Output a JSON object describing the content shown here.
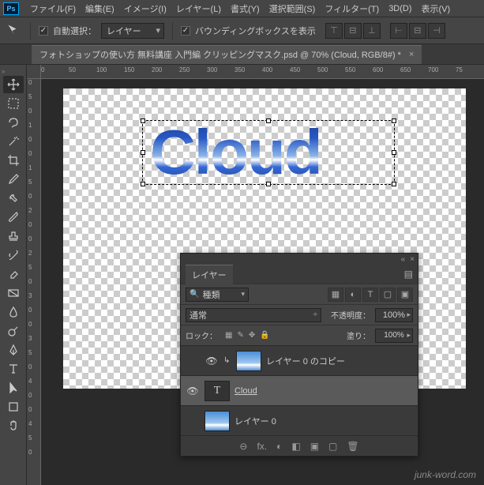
{
  "app": {
    "logo": "Ps"
  },
  "menu": [
    "ファイル(F)",
    "編集(E)",
    "イメージ(I)",
    "レイヤー(L)",
    "書式(Y)",
    "選択範囲(S)",
    "フィルター(T)",
    "3D(D)",
    "表示(V)"
  ],
  "options": {
    "auto_select_label": "自動選択：",
    "auto_select_value": "レイヤー",
    "bbox_label": "バウンディングボックスを表示"
  },
  "doc_tab": {
    "title": "フォトショップの使い方 無料講座 入門編 クリッピングマスク.psd @ 70% (Cloud, RGB/8#) *",
    "close": "×"
  },
  "ruler_h": [
    "0",
    "50",
    "100",
    "150",
    "200",
    "250",
    "300",
    "350",
    "400",
    "450",
    "500",
    "550",
    "600",
    "650",
    "700",
    "75"
  ],
  "ruler_v": [
    "0",
    "5",
    "0",
    "1",
    "0",
    "0",
    "1",
    "5",
    "0",
    "2",
    "0",
    "0",
    "2",
    "5",
    "0",
    "3",
    "0",
    "0",
    "3",
    "5",
    "0",
    "4",
    "0",
    "0",
    "4",
    "5",
    "0"
  ],
  "canvas": {
    "cloud_text": "Cloud"
  },
  "layers_panel": {
    "title": "レイヤー",
    "filter_label": "種類",
    "blend_mode": "通常",
    "opacity_label": "不透明度：",
    "opacity_value": "100%",
    "lock_label": "ロック：",
    "fill_label": "塗り：",
    "fill_value": "100%",
    "layers": [
      {
        "name": "レイヤー 0 のコピー",
        "visible": true,
        "clip": true,
        "thumb": "sky"
      },
      {
        "name": "Cloud",
        "visible": true,
        "thumb": "text",
        "selected": true,
        "underline": true
      },
      {
        "name": "レイヤー 0",
        "visible": false,
        "thumb": "sky"
      }
    ],
    "footer_icons": [
      "⊖",
      "fx.",
      "◐",
      "◧",
      "▣",
      "▢",
      "🗑"
    ]
  },
  "watermark": "junk-word.com"
}
